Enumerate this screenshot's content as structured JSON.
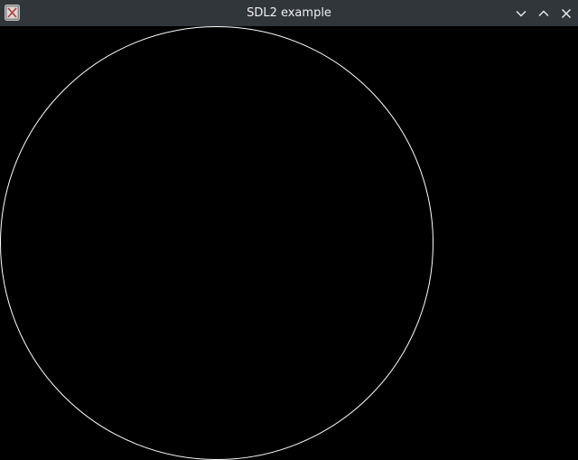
{
  "window": {
    "title": "SDL2 example",
    "icon": "x11-app-icon",
    "controls": [
      "minimize-icon",
      "maximize-icon",
      "close-icon"
    ]
  },
  "canvas": {
    "background": "#000000",
    "shape": "circle",
    "stroke_color": "#ffffff"
  },
  "colors": {
    "titlebar": "#31363b",
    "title_text": "#eff0f1"
  }
}
